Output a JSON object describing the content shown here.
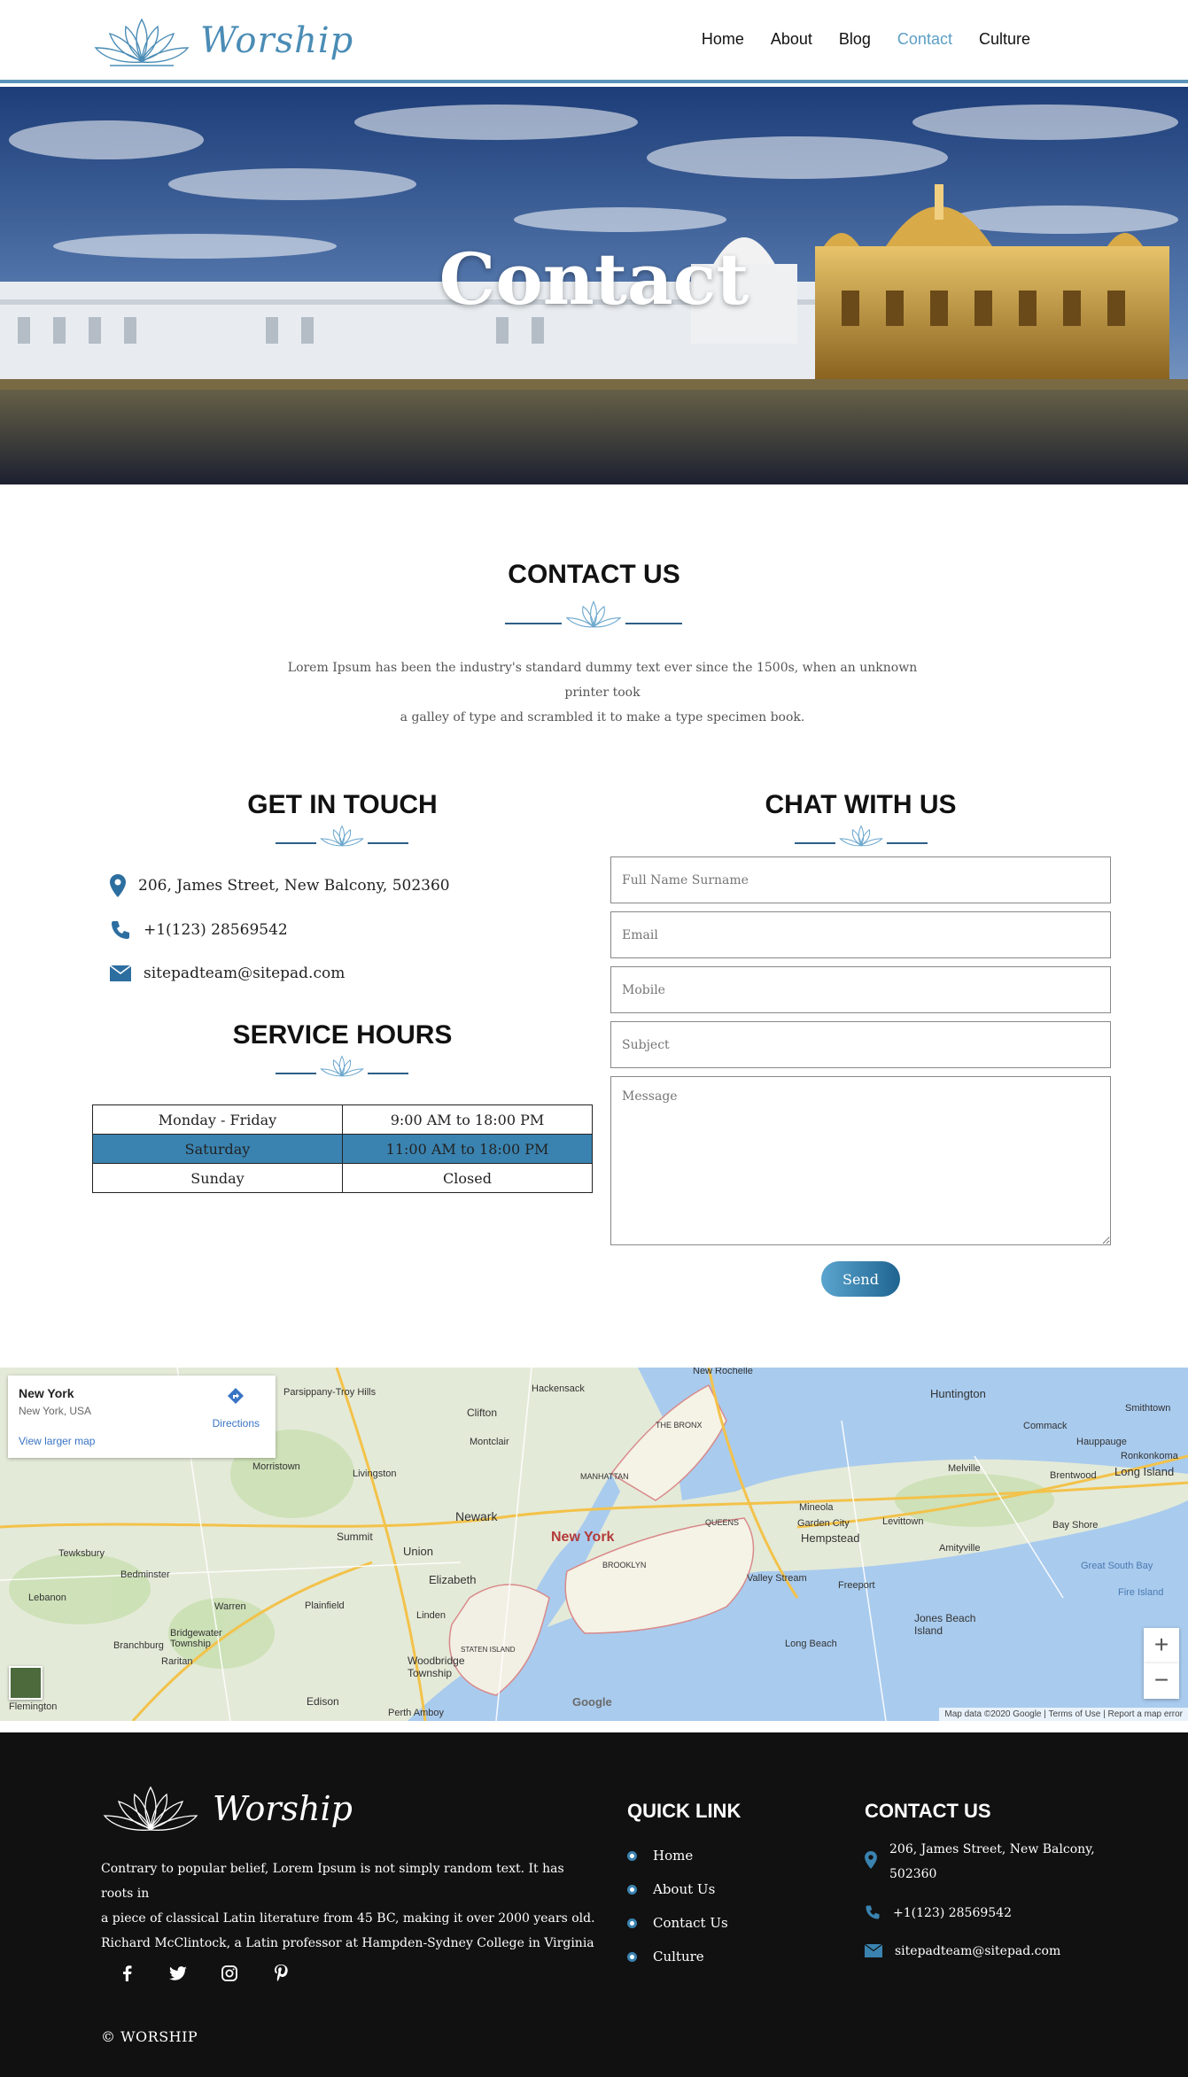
{
  "nav": {
    "brand": "Worship",
    "items": [
      {
        "label": "Home",
        "active": false
      },
      {
        "label": "About",
        "active": false
      },
      {
        "label": "Blog",
        "active": false
      },
      {
        "label": "Contact",
        "active": true
      },
      {
        "label": "Culture",
        "active": false
      }
    ],
    "active_color": "#5c9ec5"
  },
  "hero": {
    "title": "Contact"
  },
  "contact_us": {
    "heading": "CONTACT US",
    "intro_line1": "Lorem Ipsum has been the industry's standard dummy text ever since the 1500s, when an unknown printer took",
    "intro_line2": "a galley of type and scrambled it to make a type specimen book."
  },
  "get_in_touch": {
    "heading": "GET IN TOUCH",
    "address": "206, James Street, New Balcony, 502360",
    "phone": "+1(123) 28569542",
    "email": "sitepadteam@sitepad.com"
  },
  "service_hours": {
    "heading": "SERVICE HOURS",
    "rows": [
      {
        "day": "Monday - Friday",
        "time": "9:00 AM to 18:00 PM",
        "highlight": false
      },
      {
        "day": "Saturday",
        "time": "11:00 AM to 18:00 PM",
        "highlight": true
      },
      {
        "day": "Sunday",
        "time": "Closed",
        "highlight": false
      }
    ],
    "highlight_color": "#3a83b0"
  },
  "chat": {
    "heading": "CHAT WITH US",
    "placeholders": {
      "name": "Full Name Surname",
      "email": "Email",
      "mobile": "Mobile",
      "subject": "Subject",
      "message": "Message"
    },
    "send_label": "Send"
  },
  "map": {
    "place": "New York",
    "place_sub": "New York, USA",
    "directions": "Directions",
    "larger": "View larger map",
    "city_label": "New York",
    "labels": {
      "clifton": "Clifton",
      "newark": "Newark",
      "elizabeth": "Elizabeth",
      "union": "Union",
      "summit": "Summit",
      "brooklyn": "BROOKLYN",
      "manhattan": "MANHATTAN",
      "queens": "QUEENS",
      "bronx": "THE BRONX",
      "hempstead": "Hempstead",
      "huntington": "Huntington",
      "long_island": "Long Island",
      "jones_beach": "Jones Beach Island",
      "staten": "STATEN ISLAND",
      "edison": "Edison",
      "woodbridge": "Woodbridge Township",
      "hackensack": "Hackensack",
      "new_rochelle": "New Rochelle",
      "great_south_bay": "Great South Bay",
      "long_beach": "Long Beach",
      "valley_stream": "Valley Stream",
      "freeport": "Freeport",
      "plainfield": "Plainfield",
      "montclair": "Montclair",
      "morristown": "Morristown",
      "livingston": "Livingston",
      "bedminster": "Bedminster",
      "raritan": "Raritan",
      "bridgewater": "Bridgewater Township",
      "perth_amboy": "Perth Amboy",
      "flemington": "Flemington",
      "parsippany": "Parsippany-Troy Hills",
      "mineola": "Mineola",
      "levittown": "Levittown",
      "melville": "Melville",
      "bay_shore": "Bay Shore",
      "commack": "Commack",
      "hauppauge": "Hauppauge",
      "ronkonkoma": "Ronkonkoma",
      "smithtown": "Smithtown",
      "brentwood": "Brentwood",
      "fire_island": "Fire Island",
      "tewksbury": "Tewksbury",
      "lebanon": "Lebanon",
      "branchburg": "Branchburg",
      "linden": "Linden",
      "warren": "Warren",
      "amityville": "Amityville",
      "garden_city": "Garden City",
      "google": "Google"
    },
    "attribution": "Map data ©2020 Google | Terms of Use | Report a map error"
  },
  "footer": {
    "brand": "Worship",
    "about_line1": "Contrary to popular belief, Lorem Ipsum is not simply random text. It has roots in",
    "about_line2": "a piece of classical Latin literature from 45 BC, making it over 2000 years old.",
    "about_line3": "Richard McClintock, a Latin professor at Hampden-Sydney College in Virginia",
    "quick_link_title": "QUICK LINK",
    "links": [
      "Home",
      "About Us",
      "Contact Us",
      "Culture"
    ],
    "contact_title": "CONTACT US",
    "address_line1": "206, James Street, New Balcony,",
    "address_line2": "502360",
    "phone": "+1(123) 28569542",
    "email": "sitepadteam@sitepad.com",
    "copyright": "© WORSHIP"
  }
}
